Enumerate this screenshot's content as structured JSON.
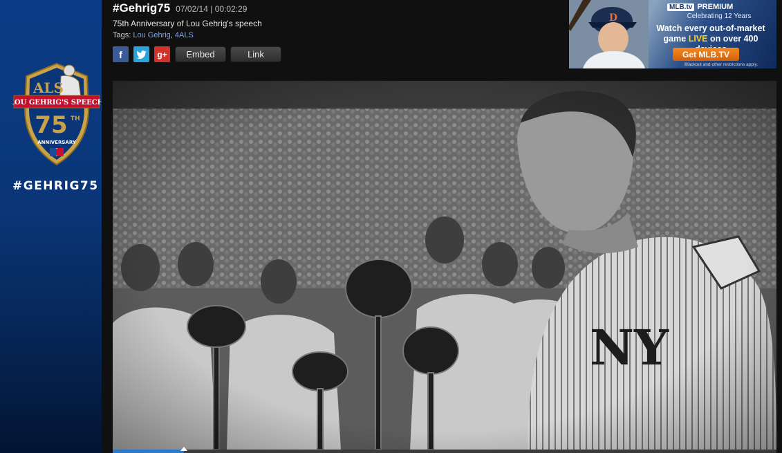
{
  "sidebar": {
    "logo": {
      "als": "ALS",
      "banner": "LOU GEHRIG'S SPEECH",
      "number": "75",
      "th": "TH",
      "anniversary": "ANNIVERSARY"
    },
    "hashtag": "#GEHRIG75"
  },
  "video": {
    "title": "#Gehrig75",
    "date": "07/02/14",
    "separator": "|",
    "duration": "00:02:29",
    "description": "75th Anniversary of Lou Gehrig's speech",
    "tags_label": "Tags:",
    "tags": [
      "Lou Gehrig",
      "4ALS"
    ],
    "progress": 0.107
  },
  "share": {
    "facebook_glyph": "f",
    "google_glyph": "g+",
    "embed_label": "Embed",
    "link_label": "Link"
  },
  "ad": {
    "brand": "MLB.tv",
    "premium": "PREMIUM",
    "celebrating": "Celebrating 12 Years",
    "headline_line1": "Watch every  out-of-market",
    "headline_pre": "game ",
    "headline_live": "LIVE",
    "headline_post": " on over 400 devices",
    "cta": "Get MLB.TV",
    "fine_print": "Blackout and other restrictions apply."
  },
  "colors": {
    "sidebar_top": "#0c3c86",
    "sidebar_bottom": "#031432",
    "logo_gold": "#c9a24a",
    "logo_red": "#c8102e",
    "tag_link": "#6fa9ff",
    "progress_fill": "#2e78c8"
  }
}
